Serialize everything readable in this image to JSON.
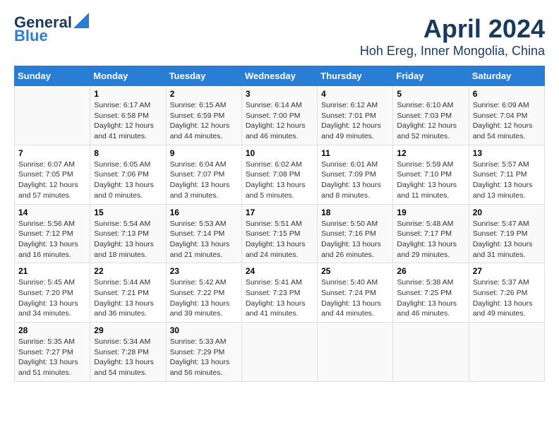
{
  "header": {
    "logo_line1": "General",
    "logo_line2": "Blue",
    "title": "April 2024",
    "subtitle": "Hoh Ereg, Inner Mongolia, China"
  },
  "days_of_week": [
    "Sunday",
    "Monday",
    "Tuesday",
    "Wednesday",
    "Thursday",
    "Friday",
    "Saturday"
  ],
  "weeks": [
    [
      {
        "day": "",
        "info": ""
      },
      {
        "day": "1",
        "info": "Sunrise: 6:17 AM\nSunset: 6:58 PM\nDaylight: 12 hours\nand 41 minutes."
      },
      {
        "day": "2",
        "info": "Sunrise: 6:15 AM\nSunset: 6:59 PM\nDaylight: 12 hours\nand 44 minutes."
      },
      {
        "day": "3",
        "info": "Sunrise: 6:14 AM\nSunset: 7:00 PM\nDaylight: 12 hours\nand 46 minutes."
      },
      {
        "day": "4",
        "info": "Sunrise: 6:12 AM\nSunset: 7:01 PM\nDaylight: 12 hours\nand 49 minutes."
      },
      {
        "day": "5",
        "info": "Sunrise: 6:10 AM\nSunset: 7:03 PM\nDaylight: 12 hours\nand 52 minutes."
      },
      {
        "day": "6",
        "info": "Sunrise: 6:09 AM\nSunset: 7:04 PM\nDaylight: 12 hours\nand 54 minutes."
      }
    ],
    [
      {
        "day": "7",
        "info": "Sunrise: 6:07 AM\nSunset: 7:05 PM\nDaylight: 12 hours\nand 57 minutes."
      },
      {
        "day": "8",
        "info": "Sunrise: 6:05 AM\nSunset: 7:06 PM\nDaylight: 13 hours\nand 0 minutes."
      },
      {
        "day": "9",
        "info": "Sunrise: 6:04 AM\nSunset: 7:07 PM\nDaylight: 13 hours\nand 3 minutes."
      },
      {
        "day": "10",
        "info": "Sunrise: 6:02 AM\nSunset: 7:08 PM\nDaylight: 13 hours\nand 5 minutes."
      },
      {
        "day": "11",
        "info": "Sunrise: 6:01 AM\nSunset: 7:09 PM\nDaylight: 13 hours\nand 8 minutes."
      },
      {
        "day": "12",
        "info": "Sunrise: 5:59 AM\nSunset: 7:10 PM\nDaylight: 13 hours\nand 11 minutes."
      },
      {
        "day": "13",
        "info": "Sunrise: 5:57 AM\nSunset: 7:11 PM\nDaylight: 13 hours\nand 13 minutes."
      }
    ],
    [
      {
        "day": "14",
        "info": "Sunrise: 5:56 AM\nSunset: 7:12 PM\nDaylight: 13 hours\nand 16 minutes."
      },
      {
        "day": "15",
        "info": "Sunrise: 5:54 AM\nSunset: 7:13 PM\nDaylight: 13 hours\nand 18 minutes."
      },
      {
        "day": "16",
        "info": "Sunrise: 5:53 AM\nSunset: 7:14 PM\nDaylight: 13 hours\nand 21 minutes."
      },
      {
        "day": "17",
        "info": "Sunrise: 5:51 AM\nSunset: 7:15 PM\nDaylight: 13 hours\nand 24 minutes."
      },
      {
        "day": "18",
        "info": "Sunrise: 5:50 AM\nSunset: 7:16 PM\nDaylight: 13 hours\nand 26 minutes."
      },
      {
        "day": "19",
        "info": "Sunrise: 5:48 AM\nSunset: 7:17 PM\nDaylight: 13 hours\nand 29 minutes."
      },
      {
        "day": "20",
        "info": "Sunrise: 5:47 AM\nSunset: 7:19 PM\nDaylight: 13 hours\nand 31 minutes."
      }
    ],
    [
      {
        "day": "21",
        "info": "Sunrise: 5:45 AM\nSunset: 7:20 PM\nDaylight: 13 hours\nand 34 minutes."
      },
      {
        "day": "22",
        "info": "Sunrise: 5:44 AM\nSunset: 7:21 PM\nDaylight: 13 hours\nand 36 minutes."
      },
      {
        "day": "23",
        "info": "Sunrise: 5:42 AM\nSunset: 7:22 PM\nDaylight: 13 hours\nand 39 minutes."
      },
      {
        "day": "24",
        "info": "Sunrise: 5:41 AM\nSunset: 7:23 PM\nDaylight: 13 hours\nand 41 minutes."
      },
      {
        "day": "25",
        "info": "Sunrise: 5:40 AM\nSunset: 7:24 PM\nDaylight: 13 hours\nand 44 minutes."
      },
      {
        "day": "26",
        "info": "Sunrise: 5:38 AM\nSunset: 7:25 PM\nDaylight: 13 hours\nand 46 minutes."
      },
      {
        "day": "27",
        "info": "Sunrise: 5:37 AM\nSunset: 7:26 PM\nDaylight: 13 hours\nand 49 minutes."
      }
    ],
    [
      {
        "day": "28",
        "info": "Sunrise: 5:35 AM\nSunset: 7:27 PM\nDaylight: 13 hours\nand 51 minutes."
      },
      {
        "day": "29",
        "info": "Sunrise: 5:34 AM\nSunset: 7:28 PM\nDaylight: 13 hours\nand 54 minutes."
      },
      {
        "day": "30",
        "info": "Sunrise: 5:33 AM\nSunset: 7:29 PM\nDaylight: 13 hours\nand 56 minutes."
      },
      {
        "day": "",
        "info": ""
      },
      {
        "day": "",
        "info": ""
      },
      {
        "day": "",
        "info": ""
      },
      {
        "day": "",
        "info": ""
      }
    ]
  ]
}
